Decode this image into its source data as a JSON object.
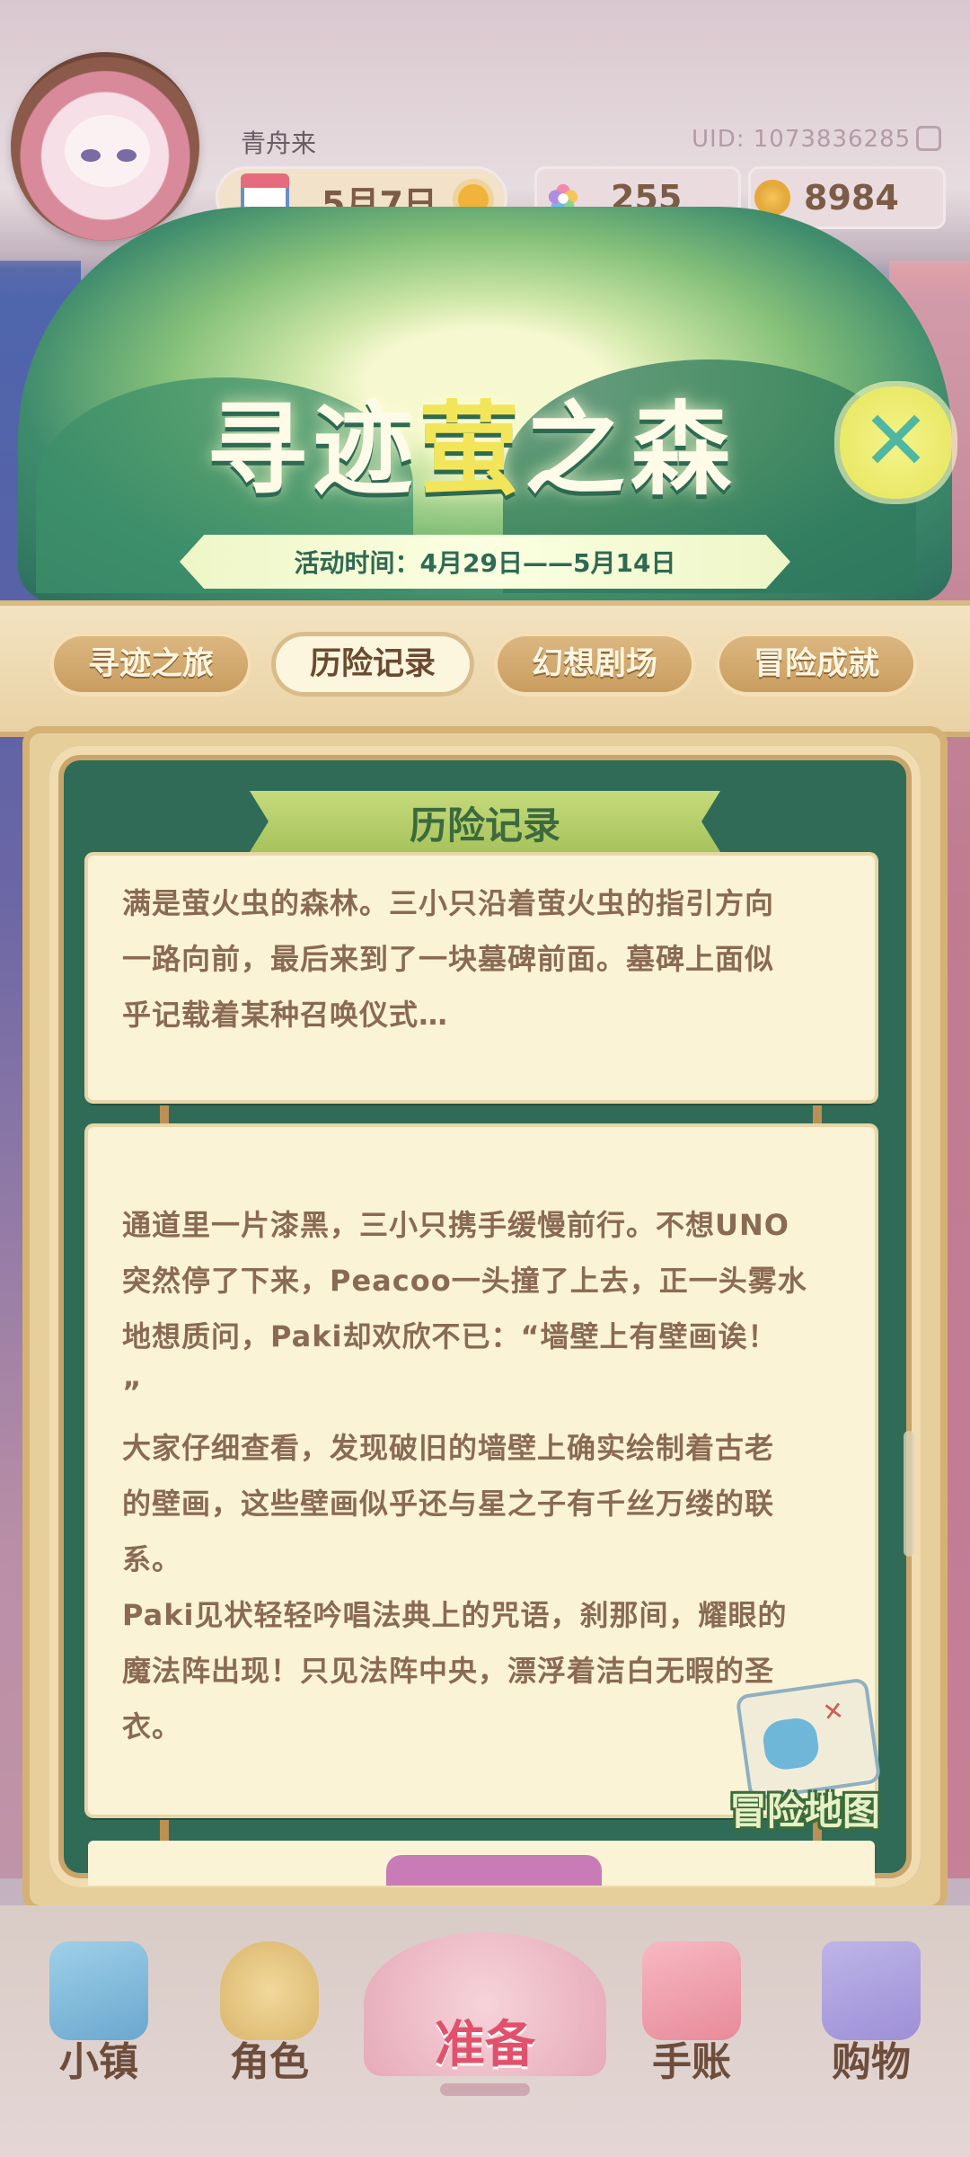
{
  "header": {
    "username": "青舟来",
    "uid": "UID: 1073836285",
    "date": "5月7日",
    "gems": "255",
    "coins": "8984"
  },
  "banner": {
    "title_part1": "寻迹",
    "title_part2": "萤",
    "title_part3": "之森",
    "period": "活动时间：4月29日——5月14日",
    "close_symbol": "✕"
  },
  "tabs": [
    {
      "label": "寻迹之旅",
      "active": false
    },
    {
      "label": "历险记录",
      "active": true
    },
    {
      "label": "幻想剧场",
      "active": false
    },
    {
      "label": "冒险成就",
      "active": false
    }
  ],
  "section": {
    "title": "历险记录"
  },
  "entries": [
    {
      "text": "满是萤火虫的森林。三小只沿着萤火虫的指引方向\n一路向前，最后来到了一块墓碑前面。墓碑上面似\n乎记载着某种召唤仪式…"
    },
    {
      "paragraph1": "通道里一片漆黑，三小只携手缓慢前行。不想UNO\n突然停了下来，Peacoo一头撞了上去，正一头雾水\n地想质问，Paki却欢欣不已：“墙壁上有壁画诶！\n”",
      "paragraph2": "大家仔细查看，发现破旧的墙壁上确实绘制着古老\n的壁画，这些壁画似乎还与星之子有千丝万缕的联\n系。",
      "paragraph3": "Paki见状轻轻吟唱法典上的咒语，刹那间，耀眼的\n魔法阵出现！只见法阵中央，漂浮着洁白无暇的圣\n衣。"
    }
  ],
  "map": {
    "label": "冒险地图"
  },
  "bottom_nav": [
    {
      "label": "小镇",
      "icon": "town-map-icon"
    },
    {
      "label": "角色",
      "icon": "character-bunny-icon"
    },
    {
      "label": "准备",
      "icon": "prepare-bouquet-icon"
    },
    {
      "label": "手账",
      "icon": "journal-book-icon"
    },
    {
      "label": "购物",
      "icon": "shopping-bag-icon"
    }
  ],
  "colors": {
    "panel_green": "#2f6b57",
    "card_paper": "#fbf3d6",
    "tab_gold": "#c89b5d",
    "accent_pink": "#e1516b"
  }
}
